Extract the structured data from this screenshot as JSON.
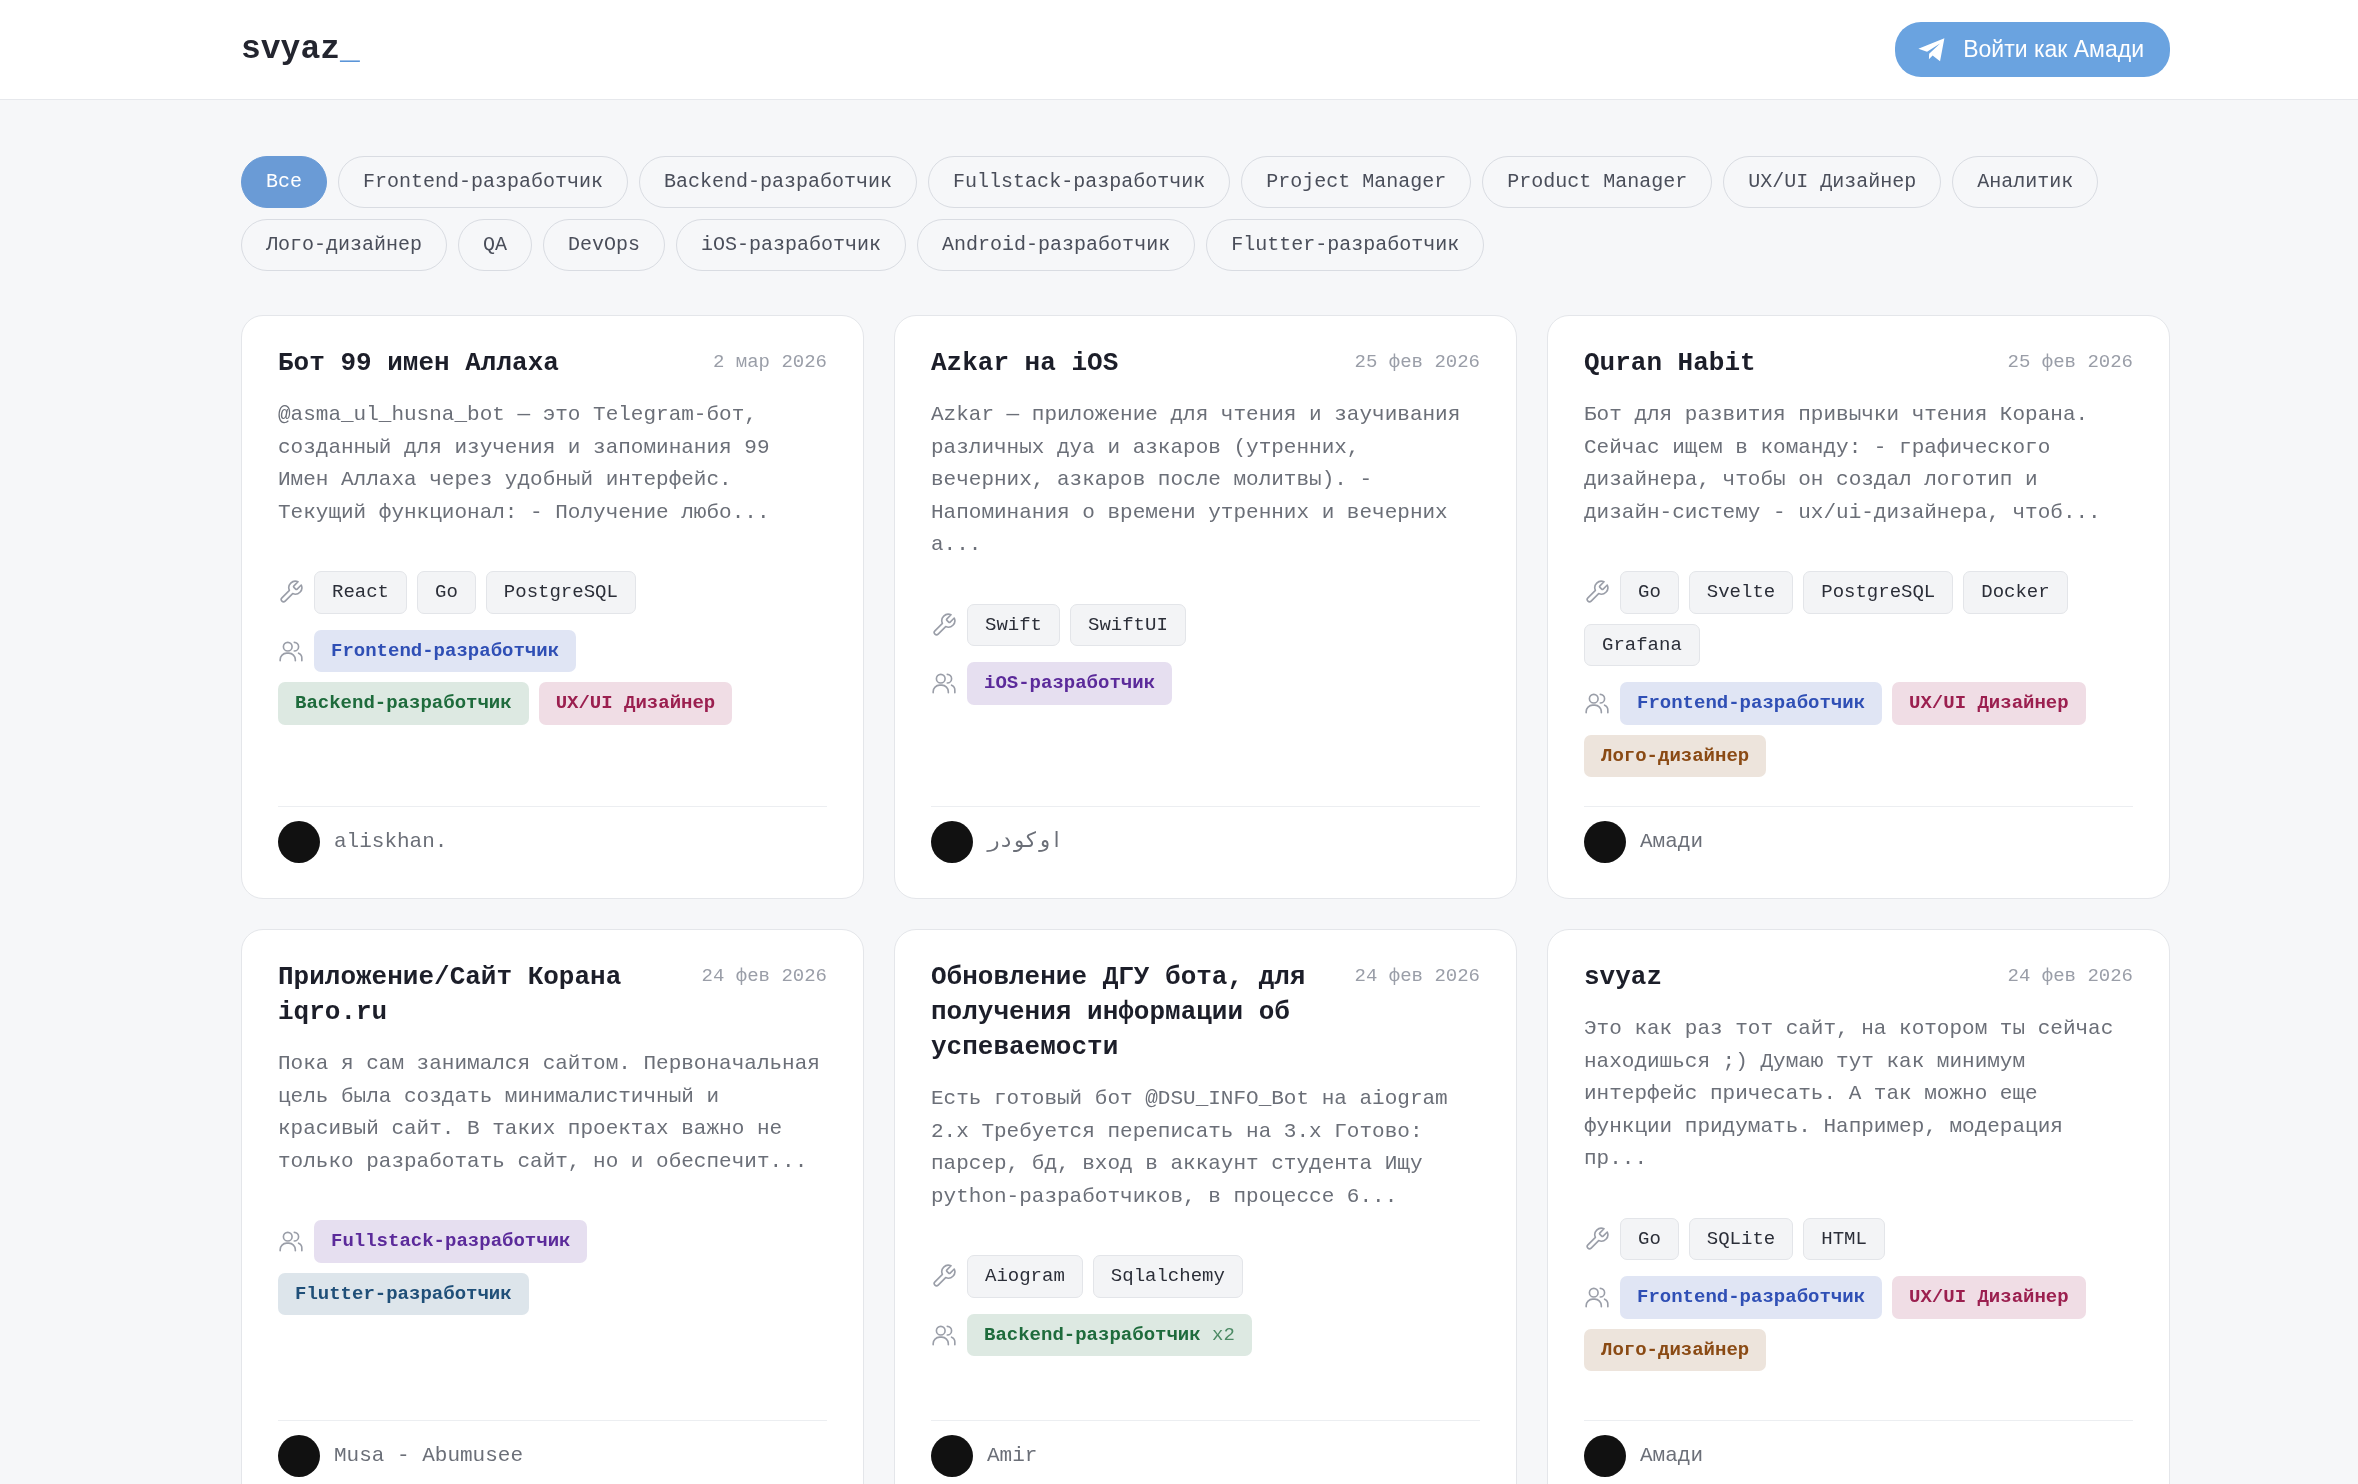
{
  "header": {
    "logo": "svyaz",
    "logo_cursor": "_",
    "login_button": "Войти как Амади"
  },
  "filters": [
    {
      "label": "Все",
      "selected": true
    },
    {
      "label": "Frontend-разработчик",
      "selected": false
    },
    {
      "label": "Backend-разработчик",
      "selected": false
    },
    {
      "label": "Fullstack-разработчик",
      "selected": false
    },
    {
      "label": "Project Manager",
      "selected": false
    },
    {
      "label": "Product Manager",
      "selected": false
    },
    {
      "label": "UX/UI Дизайнер",
      "selected": false
    },
    {
      "label": "Аналитик",
      "selected": false
    },
    {
      "label": "Лого-дизайнер",
      "selected": false
    },
    {
      "label": "QA",
      "selected": false
    },
    {
      "label": "DevOps",
      "selected": false
    },
    {
      "label": "iOS-разработчик",
      "selected": false
    },
    {
      "label": "Android-разработчик",
      "selected": false
    },
    {
      "label": "Flutter-разработчик",
      "selected": false
    }
  ],
  "projects": [
    {
      "title": "Бот 99 имен Аллаха",
      "date": "2 мар 2026",
      "description": "@asma_ul_husna_bot — это Telegram-бот, созданный для изучения и запоминания 99 Имен Аллаха через удобный интерфейс. Текущий функционал: - Получение любо...",
      "tech": [
        "React",
        "Go",
        "PostgreSQL"
      ],
      "roles": [
        {
          "label": "Frontend-разработчик",
          "color": "#2f4fb5"
        },
        {
          "label": "Backend-разработчик",
          "color": "#1e6b3c"
        },
        {
          "label": "UX/UI Дизайнер",
          "color": "#9b1f4f"
        }
      ],
      "author": "aliskhan."
    },
    {
      "title": "Azkar на iOS",
      "date": "25 фев 2026",
      "description": "Azkar — приложение для чтения и заучивания различных дуа и азкаров (утренних, вечерних, азкаров после молитвы). - Напоминания о времени утренних и вечерних а...",
      "tech": [
        "Swift",
        "SwiftUI"
      ],
      "roles": [
        {
          "label": "iOS-разработчик",
          "color": "#5b2a9a"
        }
      ],
      "author": "اوكودر"
    },
    {
      "title": "Quran Habit",
      "date": "25 фев 2026",
      "description": "Бот для развития привычки чтения Корана. Сейчас ищем в команду: - графического дизайнера, чтобы он создал логотип и дизайн-систему - ux/ui-дизайнера, чтоб...",
      "tech": [
        "Go",
        "Svelte",
        "PostgreSQL",
        "Docker",
        "Grafana"
      ],
      "roles": [
        {
          "label": "Frontend-разработчик",
          "color": "#2f4fb5"
        },
        {
          "label": "UX/UI Дизайнер",
          "color": "#9b1f4f"
        },
        {
          "label": "Лого-дизайнер",
          "color": "#8a4a14"
        }
      ],
      "author": "Амади"
    },
    {
      "title": "Приложение/Сайт Корана iqro.ru",
      "date": "24 фев 2026",
      "description": "Пока я сам занимался сайтом. Первоначальная цель была создать минималистичный и красивый сайт. В таких проектах важно не только разработать сайт, но и обеспечит...",
      "roles": [
        {
          "label": "Fullstack-разработчик",
          "color": "#5b2a9a"
        },
        {
          "label": "Flutter-разработчик",
          "color": "#1f4f78"
        }
      ],
      "author": "Musa - Abumusee"
    },
    {
      "title": "Обновление ДГУ бота, для получения информации об успеваемости",
      "date": "24 фев 2026",
      "description": "Есть готовый бот @DSU_INFO_Bot на aiogram 2.x Требуется переписать на 3.x Готово: парсер, бд, вход в аккаунт студента Ищу python-разработчиков, в процессе 6...",
      "tech": [
        "Aiogram",
        "Sqlalchemy"
      ],
      "roles": [
        {
          "label": "Backend-разработчик",
          "color": "#1e6b3c",
          "count": "x2"
        }
      ],
      "author": "Amir"
    },
    {
      "title": "svyaz",
      "date": "24 фев 2026",
      "description": "Это как раз тот сайт, на котором ты сейчас находишься ;) Думаю тут как минимум интерфейс причесать. А так можно еще функции придумать. Например, модерация пр...",
      "tech": [
        "Go",
        "SQLite",
        "HTML"
      ],
      "roles": [
        {
          "label": "Frontend-разработчик",
          "color": "#2f4fb5"
        },
        {
          "label": "UX/UI Дизайнер",
          "color": "#9b1f4f"
        },
        {
          "label": "Лого-дизайнер",
          "color": "#8a4a14"
        }
      ],
      "author": "Амади"
    }
  ]
}
